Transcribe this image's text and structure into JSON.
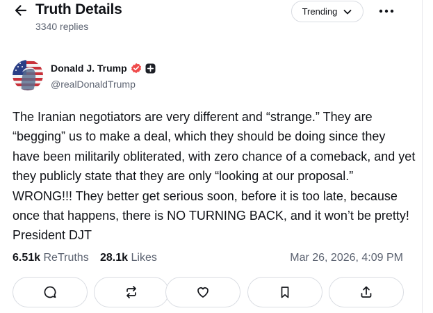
{
  "header": {
    "title": "Truth Details",
    "replies": "3340 replies",
    "feed_filter": "Trending",
    "icons": {
      "back": "arrow-left-icon",
      "filter": "chevron-down-icon",
      "more": "more-horizontal-icon"
    }
  },
  "post": {
    "author": {
      "display_name": "Donald J. Trump",
      "handle": "@realDonaldTrump",
      "verified_badge": "verified-badge-icon",
      "affiliate_badge": "plus-badge-icon"
    },
    "text": "The Iranian negotiators are very different and “strange.” They are “begging” us to make a deal, which they should be doing since they have been militarily obliterated, with zero chance of a comeback, and yet they publicly state that they are only “looking at our proposal.” WRONG!!! They better get serious soon, before it is too late, because once that happens, there is NO TURNING BACK, and it won’t be pretty! President DJT",
    "stats": {
      "retruths_count": "6.51k",
      "retruths_label": "ReTruths",
      "likes_count": "28.1k",
      "likes_label": "Likes"
    },
    "timestamp": "Mar 26, 2026, 4:09 PM"
  },
  "actions": [
    {
      "name": "reply",
      "icon": "comment-icon"
    },
    {
      "name": "retruth",
      "icon": "repost-icon"
    },
    {
      "name": "like",
      "icon": "heart-icon"
    },
    {
      "name": "bookmark",
      "icon": "bookmark-icon"
    },
    {
      "name": "share",
      "icon": "share-icon"
    }
  ],
  "colors": {
    "text": "#111318",
    "muted": "#5b6270",
    "border": "#d9dce2",
    "verified": "#ef4a4a",
    "badge_dark": "#1c1f26"
  }
}
